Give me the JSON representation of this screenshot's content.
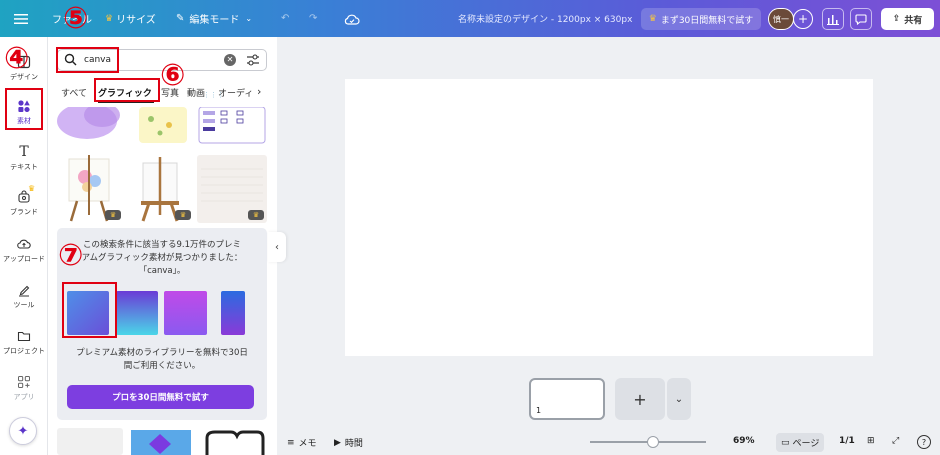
{
  "topbar": {
    "menu_label": "ファイル",
    "resize_label": "リサイズ",
    "edit_mode_label": "編集モード",
    "doc_title": "名称未設定のデザイン - 1200px × 630px",
    "trial_label": "まず30日間無料で試す",
    "avatar_label": "慎一",
    "share_label": "共有"
  },
  "rail": {
    "items": [
      {
        "label": "デザイン"
      },
      {
        "label": "素材"
      },
      {
        "label": "テキスト"
      },
      {
        "label": "ブランド"
      },
      {
        "label": "アップロード"
      },
      {
        "label": "ツール"
      },
      {
        "label": "プロジェクト"
      },
      {
        "label": "アプリ"
      }
    ]
  },
  "panel": {
    "search_value": "canva",
    "tabs": [
      "すべて",
      "グラフィック",
      "写真",
      "動画",
      "オーディ"
    ],
    "promo_line1": "この検索条件に該当する9.1万件のプレミ",
    "promo_line2": "アムグラフィック素材が見つかりました：",
    "promo_line3": "「canva」。",
    "promo_line4": "プレミアム素材のライブラリーを無料で30日",
    "promo_line5": "間ご利用ください。",
    "pro_button": "プロを30日間無料で試す"
  },
  "canvas": {
    "page_number": "1"
  },
  "bottombar": {
    "memo_label": "メモ",
    "time_label": "時間",
    "zoom": "69%",
    "pages_label": "ページ",
    "page_count": "1/1"
  },
  "annotations": {
    "n4": "④",
    "n5": "⑤",
    "n6": "⑥",
    "n7": "⑦"
  },
  "colors": {
    "accent": "#7d3ee0",
    "annotation": "#e00012"
  }
}
